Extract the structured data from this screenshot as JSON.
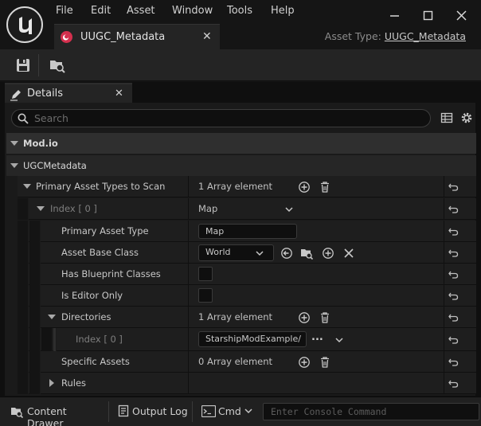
{
  "menu": [
    "File",
    "Edit",
    "Asset",
    "Window",
    "Tools",
    "Help"
  ],
  "tab": {
    "title": "UUGC_Metadata"
  },
  "asset_type": {
    "label": "Asset Type:",
    "value": "UUGC_Metadata"
  },
  "toolbar": {
    "save_icon": "save-icon",
    "browse_icon": "browse-icon"
  },
  "details_tab": {
    "label": "Details"
  },
  "search": {
    "placeholder": "Search"
  },
  "categories": {
    "modio": "Mod.io",
    "ugc": "UGCMetadata"
  },
  "rows": {
    "primary_types": {
      "name": "Primary Asset Types to Scan",
      "value": "1 Array element"
    },
    "index0": {
      "name": "Index [ 0 ]",
      "value": "Map"
    },
    "primary_asset_type": {
      "name": "Primary Asset Type",
      "value": "Map"
    },
    "asset_base_class": {
      "name": "Asset Base Class",
      "value": "World"
    },
    "has_bp_classes": {
      "name": "Has Blueprint Classes",
      "checked": false
    },
    "is_editor_only": {
      "name": "Is Editor Only",
      "checked": false
    },
    "directories": {
      "name": "Directories",
      "value": "1 Array element"
    },
    "dir_index0": {
      "name": "Index [ 0 ]",
      "value": "StarshipModExample/",
      "more": "..."
    },
    "specific_assets": {
      "name": "Specific Assets",
      "value": "0 Array element"
    },
    "rules": {
      "name": "Rules"
    }
  },
  "statusbar": {
    "content_drawer": "Content Drawer",
    "output_log": "Output Log",
    "cmd": "Cmd",
    "console_placeholder": "Enter Console Command"
  },
  "colors": {
    "accent_tab_icon": "#d4304e",
    "panel_bg": "#1a1a1a",
    "category_bg": "#2f2f2f"
  }
}
